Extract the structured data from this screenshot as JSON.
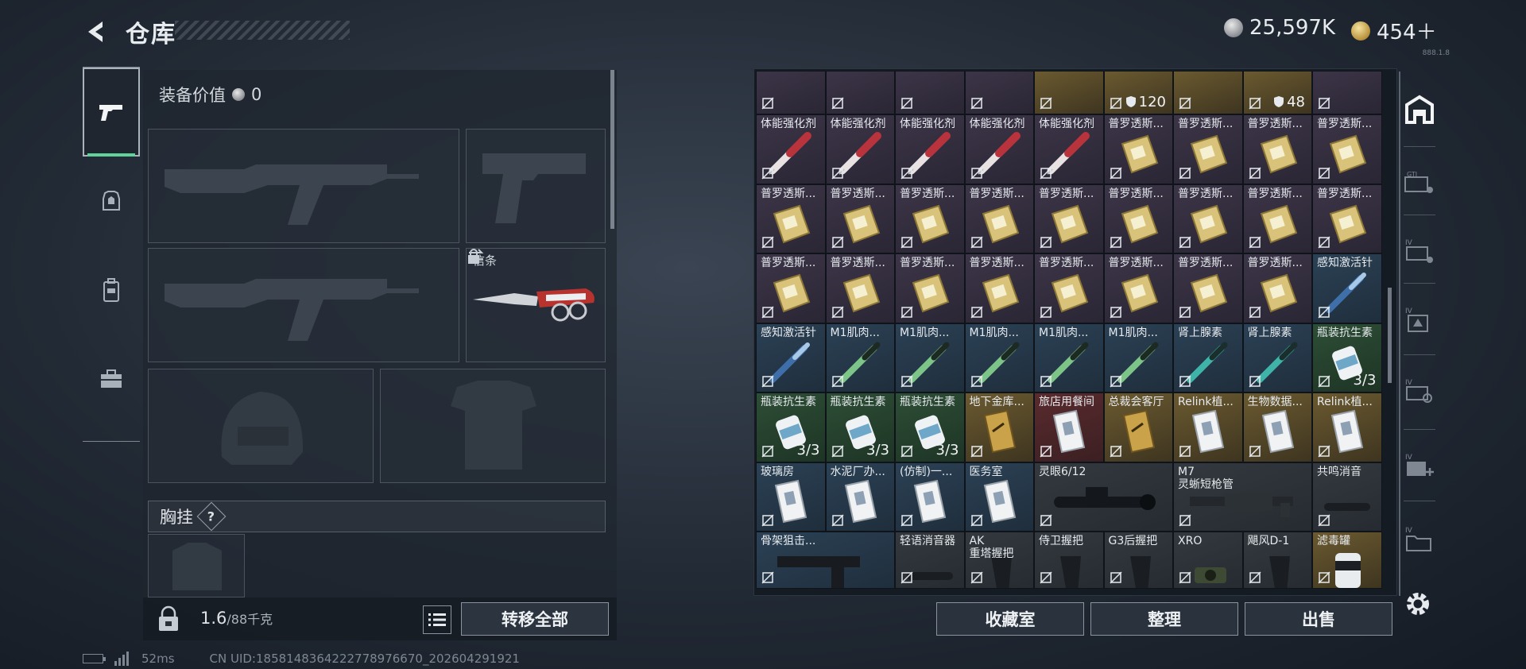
{
  "header": {
    "title": "仓库",
    "currency_primary": "25,597K",
    "currency_secondary": "454＋",
    "tiny_code": "888.1.8"
  },
  "left_panel": {
    "equip_value_label": "装备价值",
    "equip_value": "0",
    "melee_slot_label": "信条",
    "chest_section_label": "胸挂",
    "help_glyph": "?",
    "weight_current": "1.6",
    "weight_max": "/88千克",
    "transfer_all_label": "转移全部"
  },
  "grid_rows": [
    [
      {
        "name": "",
        "bg": "purple",
        "badge": ""
      },
      {
        "name": "",
        "bg": "purple",
        "badge": ""
      },
      {
        "name": "",
        "bg": "purple",
        "badge": ""
      },
      {
        "name": "",
        "bg": "purple",
        "badge": ""
      },
      {
        "name": "",
        "bg": "gold",
        "badge": ""
      },
      {
        "name": "",
        "bg": "gold",
        "badge": "120"
      },
      {
        "name": "",
        "bg": "gold",
        "badge": ""
      },
      {
        "name": "",
        "bg": "gold",
        "badge": "48"
      },
      {
        "name": "",
        "bg": "purple",
        "badge": ""
      }
    ],
    [
      {
        "name": "体能强化剂",
        "bg": "purple",
        "icon": "syringe-red"
      },
      {
        "name": "体能强化剂",
        "bg": "purple",
        "icon": "syringe-red"
      },
      {
        "name": "体能强化剂",
        "bg": "purple",
        "icon": "syringe-red"
      },
      {
        "name": "体能强化剂",
        "bg": "purple",
        "icon": "syringe-red"
      },
      {
        "name": "体能强化剂",
        "bg": "purple",
        "icon": "syringe-red"
      },
      {
        "name": "普罗透斯...",
        "bg": "purple",
        "icon": "gold-card"
      },
      {
        "name": "普罗透斯...",
        "bg": "purple",
        "icon": "gold-card"
      },
      {
        "name": "普罗透斯...",
        "bg": "purple",
        "icon": "gold-card"
      },
      {
        "name": "普罗透斯...",
        "bg": "purple",
        "icon": "gold-card"
      }
    ],
    [
      {
        "name": "普罗透斯...",
        "bg": "purple",
        "icon": "gold-card"
      },
      {
        "name": "普罗透斯...",
        "bg": "purple",
        "icon": "gold-card"
      },
      {
        "name": "普罗透斯...",
        "bg": "purple",
        "icon": "gold-card"
      },
      {
        "name": "普罗透斯...",
        "bg": "purple",
        "icon": "gold-card"
      },
      {
        "name": "普罗透斯...",
        "bg": "purple",
        "icon": "gold-card"
      },
      {
        "name": "普罗透斯...",
        "bg": "purple",
        "icon": "gold-card"
      },
      {
        "name": "普罗透斯...",
        "bg": "purple",
        "icon": "gold-card"
      },
      {
        "name": "普罗透斯...",
        "bg": "purple",
        "icon": "gold-card"
      },
      {
        "name": "普罗透斯...",
        "bg": "purple",
        "icon": "gold-card"
      }
    ],
    [
      {
        "name": "普罗透斯...",
        "bg": "purple",
        "icon": "gold-card"
      },
      {
        "name": "普罗透斯...",
        "bg": "purple",
        "icon": "gold-card"
      },
      {
        "name": "普罗透斯...",
        "bg": "purple",
        "icon": "gold-card"
      },
      {
        "name": "普罗透斯...",
        "bg": "purple",
        "icon": "gold-card"
      },
      {
        "name": "普罗透斯...",
        "bg": "purple",
        "icon": "gold-card"
      },
      {
        "name": "普罗透斯...",
        "bg": "purple",
        "icon": "gold-card"
      },
      {
        "name": "普罗透斯...",
        "bg": "purple",
        "icon": "gold-card"
      },
      {
        "name": "普罗透斯...",
        "bg": "purple",
        "icon": "gold-card"
      },
      {
        "name": "感知激活针",
        "bg": "blue",
        "icon": "syringe-blue"
      }
    ],
    [
      {
        "name": "感知激活针",
        "bg": "blue",
        "icon": "syringe-blue"
      },
      {
        "name": "M1肌肉...",
        "bg": "blue",
        "icon": "syringe-green"
      },
      {
        "name": "M1肌肉...",
        "bg": "blue",
        "icon": "syringe-green"
      },
      {
        "name": "M1肌肉...",
        "bg": "blue",
        "icon": "syringe-green"
      },
      {
        "name": "M1肌肉...",
        "bg": "blue",
        "icon": "syringe-green"
      },
      {
        "name": "M1肌肉...",
        "bg": "blue",
        "icon": "syringe-green"
      },
      {
        "name": "肾上腺素",
        "bg": "blue",
        "icon": "syringe-teal"
      },
      {
        "name": "肾上腺素",
        "bg": "blue",
        "icon": "syringe-teal"
      },
      {
        "name": "瓶装抗生素",
        "bg": "green",
        "icon": "bottle",
        "count": "3/3"
      }
    ],
    [
      {
        "name": "瓶装抗生素",
        "bg": "green",
        "icon": "bottle",
        "count": "3/3"
      },
      {
        "name": "瓶装抗生素",
        "bg": "green",
        "icon": "bottle",
        "count": "3/3"
      },
      {
        "name": "瓶装抗生素",
        "bg": "green",
        "icon": "bottle",
        "count": "3/3"
      },
      {
        "name": "地下金库...",
        "bg": "gold",
        "icon": "keycard-gold"
      },
      {
        "name": "旅店用餐间",
        "bg": "red",
        "icon": "keycard-white"
      },
      {
        "name": "总裁会客厅",
        "bg": "gold",
        "icon": "keycard-gold"
      },
      {
        "name": "Relink植...",
        "bg": "gold",
        "icon": "keycard-white"
      },
      {
        "name": "生物数据...",
        "bg": "gold",
        "icon": "keycard-white"
      },
      {
        "name": "Relink植...",
        "bg": "gold",
        "icon": "keycard-white"
      }
    ],
    [
      {
        "name": "玻璃房",
        "bg": "blue",
        "icon": "keycard-white"
      },
      {
        "name": "水泥厂办...",
        "bg": "blue",
        "icon": "keycard-white"
      },
      {
        "name": "(仿制)一...",
        "bg": "blue",
        "icon": "keycard-white"
      },
      {
        "name": "医务室",
        "bg": "blue",
        "icon": "keycard-white"
      },
      {
        "name": "灵眼6/12",
        "bg": "gray",
        "icon": "scope",
        "span": 2
      },
      {
        "name": "M7\n灵蜥短枪管",
        "bg": "gray",
        "icon": "barrel",
        "span": 2
      },
      {
        "name": "共鸣消音",
        "bg": "gray",
        "icon": "suppressor"
      }
    ],
    [
      {
        "name": "骨架狙击...",
        "bg": "blue",
        "icon": "stock",
        "span": 2
      },
      {
        "name": "轻语消音器",
        "bg": "gray",
        "icon": "suppressor"
      },
      {
        "name": "AK\n重塔握把",
        "bg": "gray",
        "icon": "grip"
      },
      {
        "name": "侍卫握把",
        "bg": "gray",
        "icon": "grip"
      },
      {
        "name": "G3后握把",
        "bg": "gray",
        "icon": "grip"
      },
      {
        "name": "XRO",
        "bg": "gray",
        "icon": "sight"
      },
      {
        "name": "飓风D-1",
        "bg": "gray",
        "icon": "grip"
      },
      {
        "name": "滤毒罐",
        "bg": "gold",
        "icon": "canister"
      }
    ]
  ],
  "grid_buttons": {
    "collection": "收藏室",
    "sort": "整理",
    "sell": "出售"
  },
  "status_bar": {
    "ping": "52ms",
    "uid": "CN UID:1858148364222778976670_202604291921"
  },
  "colors": {
    "accent_green": "#5fd39a",
    "bg_purple": "#3c3548",
    "bg_gold": "#6b5a30",
    "bg_blue": "#2b4155"
  }
}
